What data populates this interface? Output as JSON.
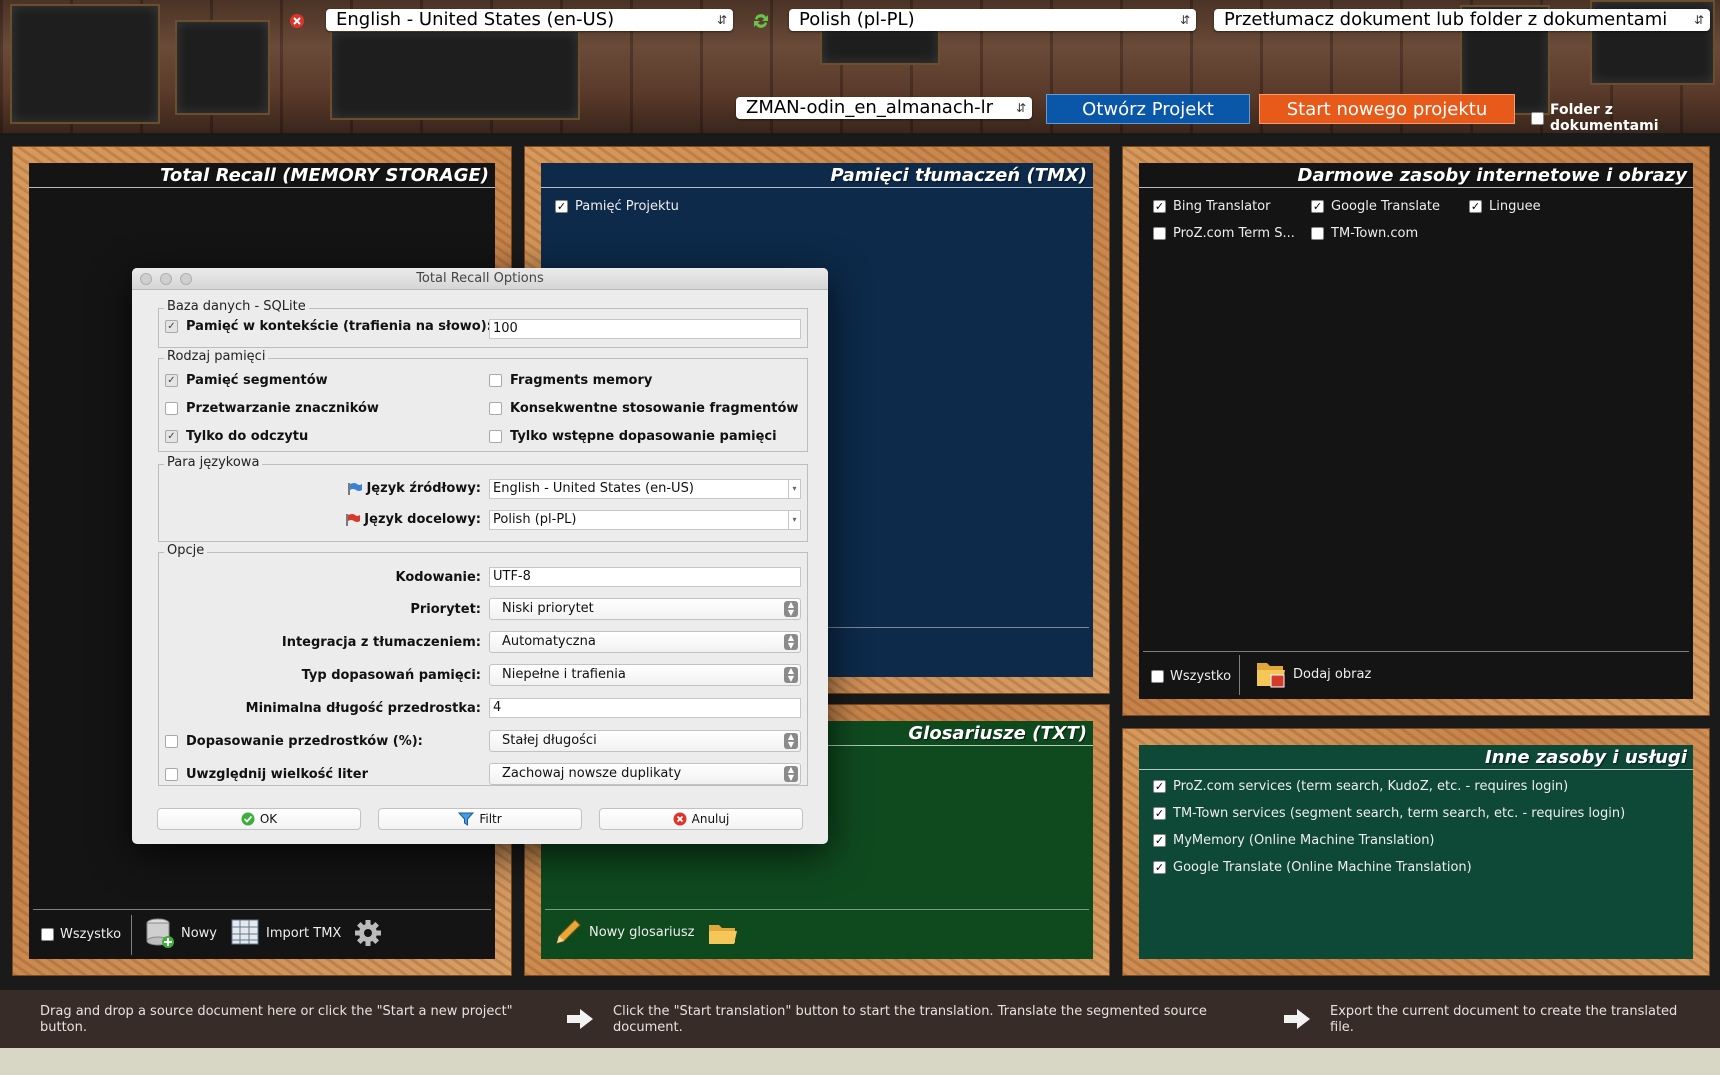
{
  "header": {
    "source_language": "English - United States (en-US)",
    "target_language": "Polish (pl-PL)",
    "mode": "Przetłumacz dokument lub folder z dokumentami",
    "project": "ZMAN-odin_en_almanach-lr",
    "open_project": "Otwórz Projekt",
    "new_project": "Start nowego projektu",
    "folder_label": "Folder z dokumentami",
    "folder_checked": false
  },
  "memory_panel": {
    "title": "Total Recall (MEMORY STORAGE)",
    "all_label": "Wszystko",
    "new_label": "Nowy",
    "import_label": "Import TMX"
  },
  "tmx_panel": {
    "title": "Pamięci tłumaczeń (TMX)",
    "items": [
      {
        "label": "Pamięć Projektu",
        "checked": true
      }
    ]
  },
  "glossary_panel": {
    "title": "Glosariusze (TXT)",
    "new_label": "Nowy glosariusz"
  },
  "internet_panel": {
    "title": "Darmowe zasoby internetowe i obrazy",
    "items": [
      {
        "label": "Bing Translator",
        "checked": true
      },
      {
        "label": "Google Translate",
        "checked": true
      },
      {
        "label": "Linguee",
        "checked": true
      },
      {
        "label": "ProZ.com Term S...",
        "checked": false
      },
      {
        "label": "TM-Town.com",
        "checked": false
      }
    ],
    "all_label": "Wszystko",
    "add_image_label": "Dodaj obraz"
  },
  "services_panel": {
    "title": "Inne zasoby i usługi",
    "items": [
      {
        "label": "ProZ.com services (term search, KudoZ, etc. - requires login)",
        "checked": true
      },
      {
        "label": "TM-Town services (segment search, term search, etc. - requires login)",
        "checked": true
      },
      {
        "label": "MyMemory (Online Machine Translation)",
        "checked": true
      },
      {
        "label": "Google Translate (Online Machine Translation)",
        "checked": true
      }
    ]
  },
  "dialog": {
    "title": "Total Recall Options",
    "db_group": "Baza danych - SQLite",
    "context_memory_label": "Pamięć w kontekście (trafienia na słowo):",
    "context_memory_value": "100",
    "memory_type_group": "Rodzaj pamięci",
    "memory_options": {
      "segment_memory": "Pamięć segmentów",
      "fragments_memory": "Fragments memory",
      "tag_processing": "Przetwarzanie znaczników",
      "consistent_fragments": "Konsekwentne stosowanie fragmentów",
      "read_only": "Tylko do odczytu",
      "pre_matching": "Tylko wstępne dopasowanie pamięci"
    },
    "language_pair_group": "Para językowa",
    "source_lang_label": "Język źródłowy:",
    "source_lang_value": "English - United States (en-US)",
    "target_lang_label": "Język docelowy:",
    "target_lang_value": "Polish (pl-PL)",
    "options_group": "Opcje",
    "encoding_label": "Kodowanie:",
    "encoding_value": "UTF-8",
    "priority_label": "Priorytet:",
    "priority_value": "Niski priorytet",
    "integration_label": "Integracja z tłumaczeniem:",
    "integration_value": "Automatyczna",
    "match_type_label": "Typ dopasowań pamięci:",
    "match_type_value": "Niepełne i trafienia",
    "min_prefix_label": "Minimalna długość przedrostka:",
    "min_prefix_value": "4",
    "prefix_match_label": "Dopasowanie przedrostków (%):",
    "prefix_match_value": "Stałej długości",
    "case_label": "Uwzględnij wielkość liter",
    "case_value": "Zachowaj nowsze duplikaty",
    "ok_label": "OK",
    "filter_label": "Filtr",
    "cancel_label": "Anuluj"
  },
  "status_bar": {
    "step1": "Drag and drop a source document here or click the \"Start a new project\" button.",
    "step2": "Click the \"Start translation\" button to start the translation. Translate the segmented source document.",
    "step3": "Export the current document to create the translated file."
  },
  "colors": {
    "tmx_bg": "#0d2a4a",
    "glossary_bg": "#0f4a1f",
    "services_bg": "#0e4836",
    "open_button": "#0a56a8",
    "new_button": "#e85a1a"
  }
}
